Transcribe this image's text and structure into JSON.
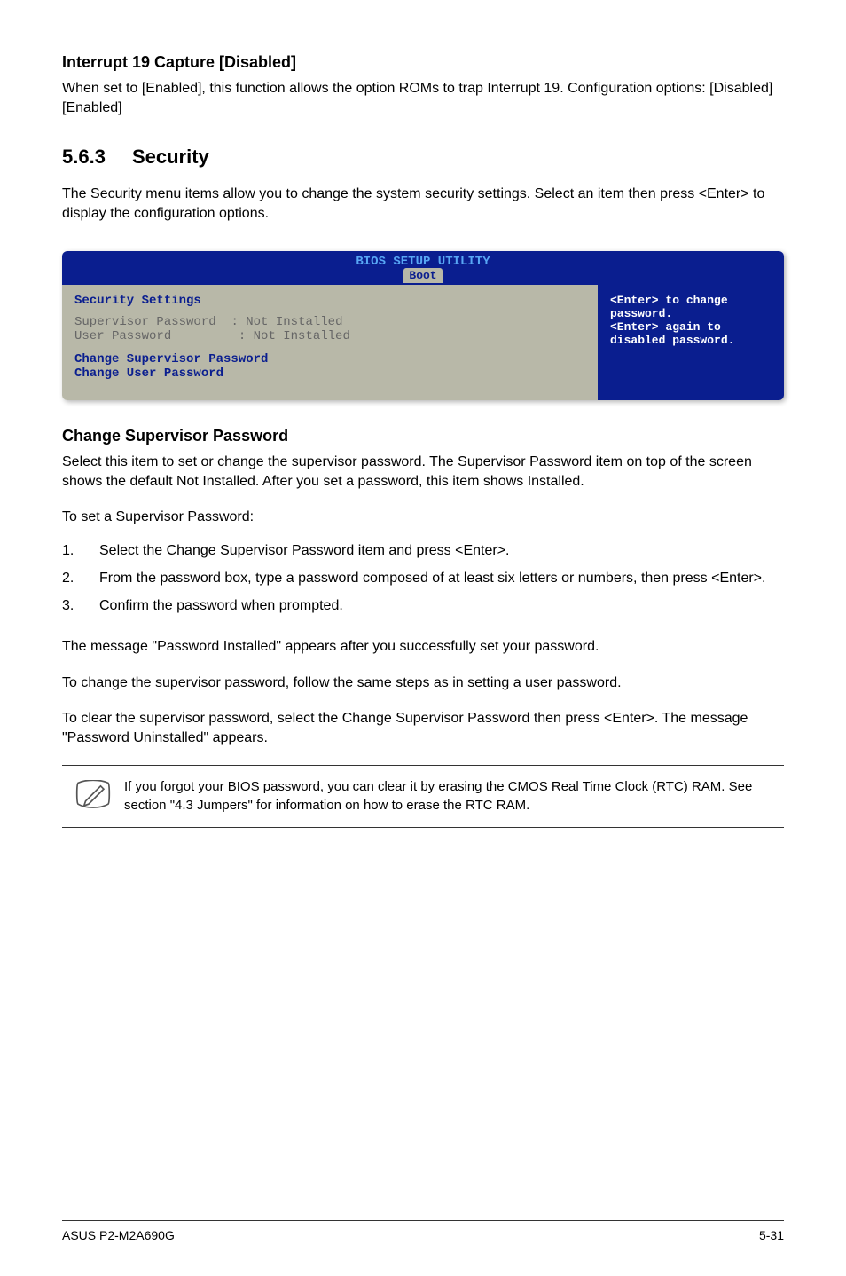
{
  "section1": {
    "heading": "Interrupt 19 Capture [Disabled]",
    "text": "When set to [Enabled], this function allows the option ROMs to trap Interrupt 19. Configuration options: [Disabled] [Enabled]"
  },
  "section2": {
    "num": "5.6.3",
    "title": "Security",
    "intro": "The Security menu items allow you to change the system security settings. Select an item then press <Enter> to display the configuration options."
  },
  "bios": {
    "title": "BIOS SETUP UTILITY",
    "tab": "Boot",
    "left_heading": "Security Settings",
    "row1_label": "Supervisor Password",
    "row1_value": ": Not Installed",
    "row2_label": "User Password",
    "row2_value": ": Not Installed",
    "item1": "Change Supervisor Password",
    "item2": "Change User Password",
    "help": "<Enter> to change password.\n<Enter> again to disabled password."
  },
  "section3": {
    "heading": "Change Supervisor Password",
    "p1": "Select this item to set or change the supervisor password. The Supervisor Password item on top of the screen shows the default Not Installed. After you set a password, this item shows Installed.",
    "p2": "To set a Supervisor Password:",
    "steps": [
      "Select the Change Supervisor Password item and press <Enter>.",
      "From the password box, type a password composed of at least six letters or numbers, then press <Enter>.",
      "Confirm the password when prompted."
    ],
    "p3": "The message \"Password Installed\" appears after you successfully set your password.",
    "p4": "To change the supervisor password, follow the same steps as in setting a user password.",
    "p5": "To clear the supervisor password, select the Change Supervisor Password then press <Enter>. The message \"Password Uninstalled\" appears."
  },
  "note": "If you forgot your BIOS password, you can clear it by erasing the CMOS Real Time Clock (RTC) RAM. See section \"4.3  Jumpers\" for information on how to erase the RTC RAM.",
  "footer": {
    "left": "ASUS P2-M2A690G",
    "right": "5-31"
  }
}
